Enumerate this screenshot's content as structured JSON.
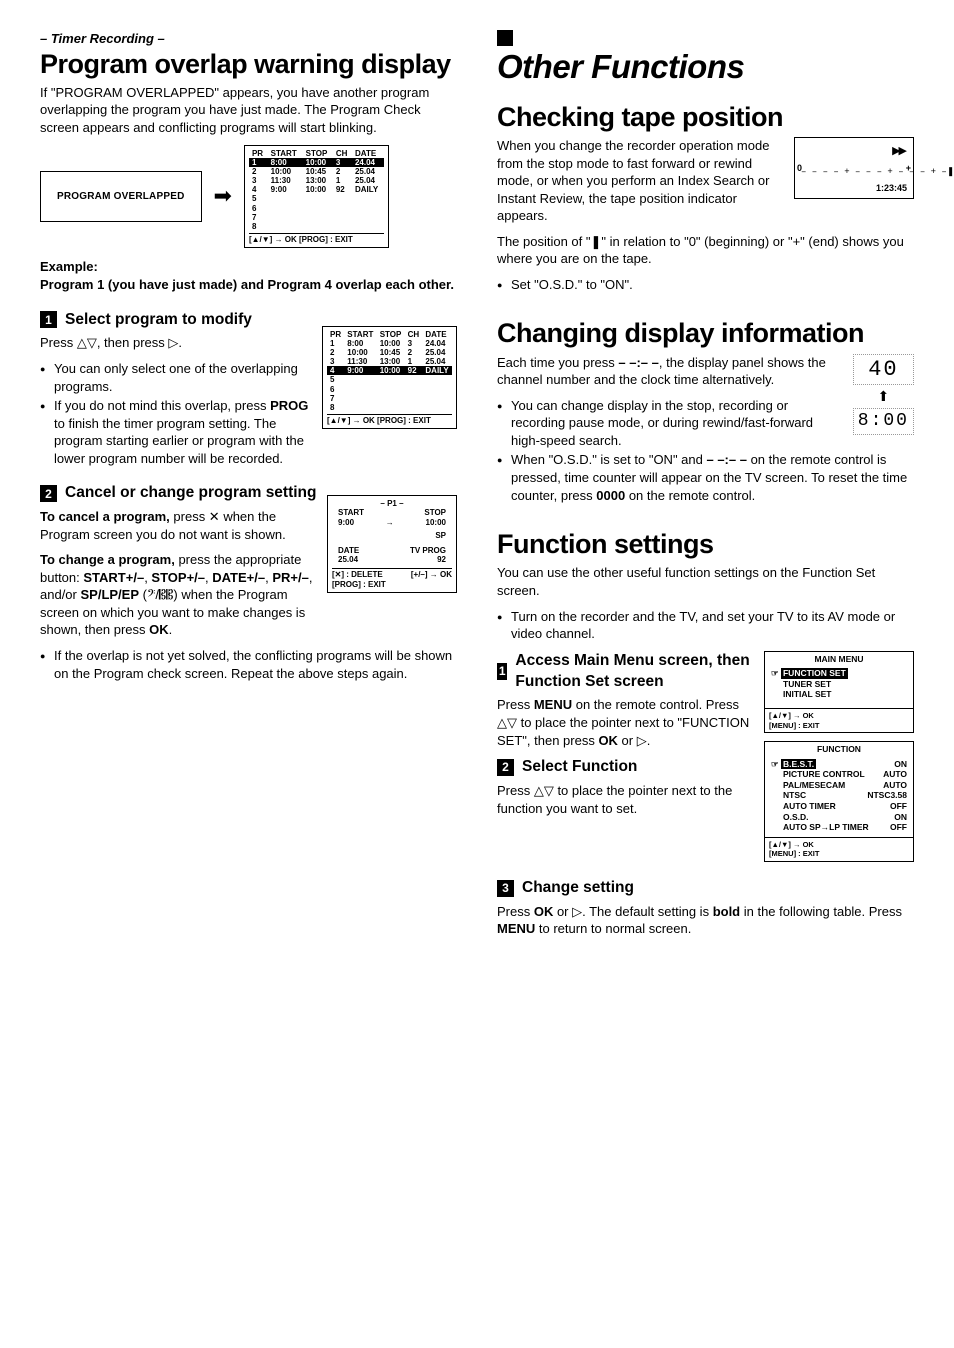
{
  "left": {
    "breadcrumb": "– Timer Recording –",
    "h1": "Program overlap warning display",
    "intro": "If \"PROGRAM OVERLAPPED\" appears, you have another program overlapping the program you have just made. The Program Check screen appears and conflicting programs will start blinking.",
    "overlapped_label": "PROGRAM OVERLAPPED",
    "example_heading": "Example:",
    "example_text": "Program 1 (you have just made) and Program 4 overlap each other.",
    "step1_title": "Select program to modify",
    "step1_press": "Press △▽, then press ▷.",
    "step1_b1": "You can only select one of the overlapping programs.",
    "step1_b2_a": "If you do not mind this overlap, press ",
    "step1_b2_prog": "PROG",
    "step1_b2_b": " to finish the timer program setting. The program starting earlier or program with the lower program number will be recorded.",
    "step2_title": "Cancel or change program setting",
    "step2_cancel_a": "To cancel a program,",
    "step2_cancel_b": " press ✕ when the Program screen you do not want is shown.",
    "step2_change_a": "To change a program,",
    "step2_change_b": " press the appropriate button: ",
    "btn_start": "START+/–",
    "btn_stop": "STOP+/–",
    "btn_date": "DATE+/–",
    "btn_pr": "PR+/–",
    "btn_sp": "SP/LP/EP",
    "step2_change_c": " (𝄢/𝄡𝄡) when the Program screen on which you want to make changes is shown, then press ",
    "ok": "OK",
    "step2_change_d": ".",
    "step2_bullet": "If the overlap is not yet solved, the conflicting programs will be shown on the Program check screen. Repeat the above steps again.",
    "osd1": {
      "headers": [
        "PR",
        "START",
        "STOP",
        "CH",
        "DATE"
      ],
      "rows": [
        [
          "1",
          "8:00",
          "10:00",
          "3",
          "24.04"
        ],
        [
          "2",
          "10:00",
          "10:45",
          "2",
          "25.04"
        ],
        [
          "3",
          "11:30",
          "13:00",
          "1",
          "25.04"
        ],
        [
          "4",
          "9:00",
          "10:00",
          "92",
          "DAILY"
        ],
        [
          "5",
          "",
          "",
          "",
          ""
        ],
        [
          "6",
          "",
          "",
          "",
          ""
        ],
        [
          "7",
          "",
          "",
          "",
          ""
        ],
        [
          "8",
          "",
          "",
          "",
          ""
        ]
      ],
      "footer": "[▲/▼] → OK    [PROG] : EXIT",
      "highlight": 0
    },
    "osd2": {
      "headers": [
        "PR",
        "START",
        "STOP",
        "CH",
        "DATE"
      ],
      "rows": [
        [
          "1",
          "8:00",
          "10:00",
          "3",
          "24.04"
        ],
        [
          "2",
          "10:00",
          "10:45",
          "2",
          "25.04"
        ],
        [
          "3",
          "11:30",
          "13:00",
          "1",
          "25.04"
        ],
        [
          "4",
          "9:00",
          "10:00",
          "92",
          "DAILY"
        ],
        [
          "5",
          "",
          "",
          "",
          ""
        ],
        [
          "6",
          "",
          "",
          "",
          ""
        ],
        [
          "7",
          "",
          "",
          "",
          ""
        ],
        [
          "8",
          "",
          "",
          "",
          ""
        ]
      ],
      "footer": "[▲/▼] → OK    [PROG] : EXIT",
      "highlight": 3
    },
    "osd3": {
      "title": "– P1 –",
      "l1a": "START",
      "l1b": "STOP",
      "l2a": "9:00",
      "l2arrow": "→",
      "l2b": "10:00",
      "sp": "SP",
      "l3a": "DATE",
      "l3b": "TV PROG",
      "l4a": "25.04",
      "l4b": "92",
      "f1": "[✕] : DELETE",
      "f1b": "[+/–] → OK",
      "f2": "[PROG] : EXIT"
    }
  },
  "right": {
    "big": "Other Functions",
    "h_tape": "Checking tape position",
    "tape_p1": "When you change the recorder operation mode from the stop mode to fast forward or rewind mode, or when you perform an Index Search or Instant Review, the tape position indicator appears.",
    "tape_p2a": "The position of \"",
    "tape_p2mark": "❚",
    "tape_p2b": "\" in relation to \"0\" (beginning) or \"+\" (end) shows you where you are on the tape.",
    "tape_b1": "Set \"O.S.D.\" to \"ON\".",
    "tape_box": {
      "ff": "▶▶",
      "zero": "0",
      "plus": "+",
      "bar": "– – – – + – – – + – – – + –❚– – –",
      "time": "1:23:45"
    },
    "h_disp": "Changing display information",
    "disp_p1a": "Each time you press ",
    "disp_key": "– –:– –",
    "disp_p1b": ", the display panel shows the channel number and the clock time alternatively.",
    "disp_b1": "You can change display in the stop, recording or recording pause mode, or during rewind/fast-forward high-speed search.",
    "disp_b2a": "When \"O.S.D.\" is set to \"ON\" and ",
    "disp_b2key": "– –:– –",
    "disp_b2b": " on the remote control is pressed, time counter will appear on the TV screen. To reset the time counter, press ",
    "disp_b2zero": "0000",
    "disp_b2c": " on the remote control.",
    "seg_top": "40",
    "seg_arrow": "⬆",
    "seg_bot": "8:00",
    "h_fn": "Function settings",
    "fn_p1": "You can use the other useful function settings on the Function Set screen.",
    "fn_b1": "Turn on the recorder and the TV, and set your TV to its AV mode or video channel.",
    "fn_s1_title": "Access Main Menu screen, then Function Set screen",
    "fn_s1_body_a": "Press ",
    "menu": "MENU",
    "fn_s1_body_b": " on the remote control. Press △▽ to place the pointer next to \"FUNCTION SET\", then press ",
    "ok": "OK",
    "fn_s1_body_c": " or ▷.",
    "fn_s2_title": "Select Function",
    "fn_s2_body": "Press △▽ to place the pointer next to the function you want to set.",
    "fn_s3_title": "Change setting",
    "fn_s3_body_a": "Press ",
    "fn_s3_body_b": " or ▷. The default setting is ",
    "bold_word": "bold",
    "fn_s3_body_c": " in the following table. Press ",
    "fn_s3_body_d": " to return to normal screen.",
    "mainmenu": {
      "title": "MAIN MENU",
      "items": [
        "FUNCTION SET",
        "TUNER SET",
        "INITIAL SET"
      ],
      "ctl": "[▲/▼] → OK\n[MENU] : EXIT"
    },
    "funcmenu": {
      "title": "FUNCTION",
      "rows": [
        [
          "B.E.S.T.",
          "ON"
        ],
        [
          "PICTURE CONTROL",
          "AUTO"
        ],
        [
          "PAL/MESECAM",
          "AUTO"
        ],
        [
          "NTSC",
          "NTSC3.58"
        ],
        [
          "AUTO TIMER",
          "OFF"
        ],
        [
          "O.S.D.",
          "ON"
        ],
        [
          "AUTO SP→LP TIMER",
          "OFF"
        ]
      ],
      "ctl": "[▲/▼] → OK\n[MENU] : EXIT"
    }
  }
}
